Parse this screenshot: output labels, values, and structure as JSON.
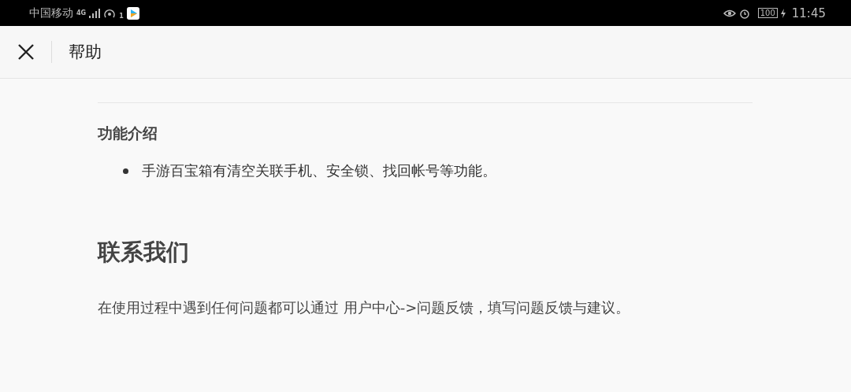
{
  "status_bar": {
    "carrier": "中国移动",
    "network_type": "4G",
    "hotspot_count": "1",
    "battery": "100",
    "time": "11:45"
  },
  "header": {
    "title": "帮助"
  },
  "sections": [
    {
      "kind": "subheading",
      "text": "功能介绍",
      "items": [
        "手游百宝箱有清空关联手机、安全锁、找回帐号等功能。"
      ]
    },
    {
      "kind": "heading",
      "text": "联系我们",
      "paragraph": "在使用过程中遇到任何问题都可以通过 用户中心->问题反馈，填写问题反馈与建议。"
    }
  ]
}
